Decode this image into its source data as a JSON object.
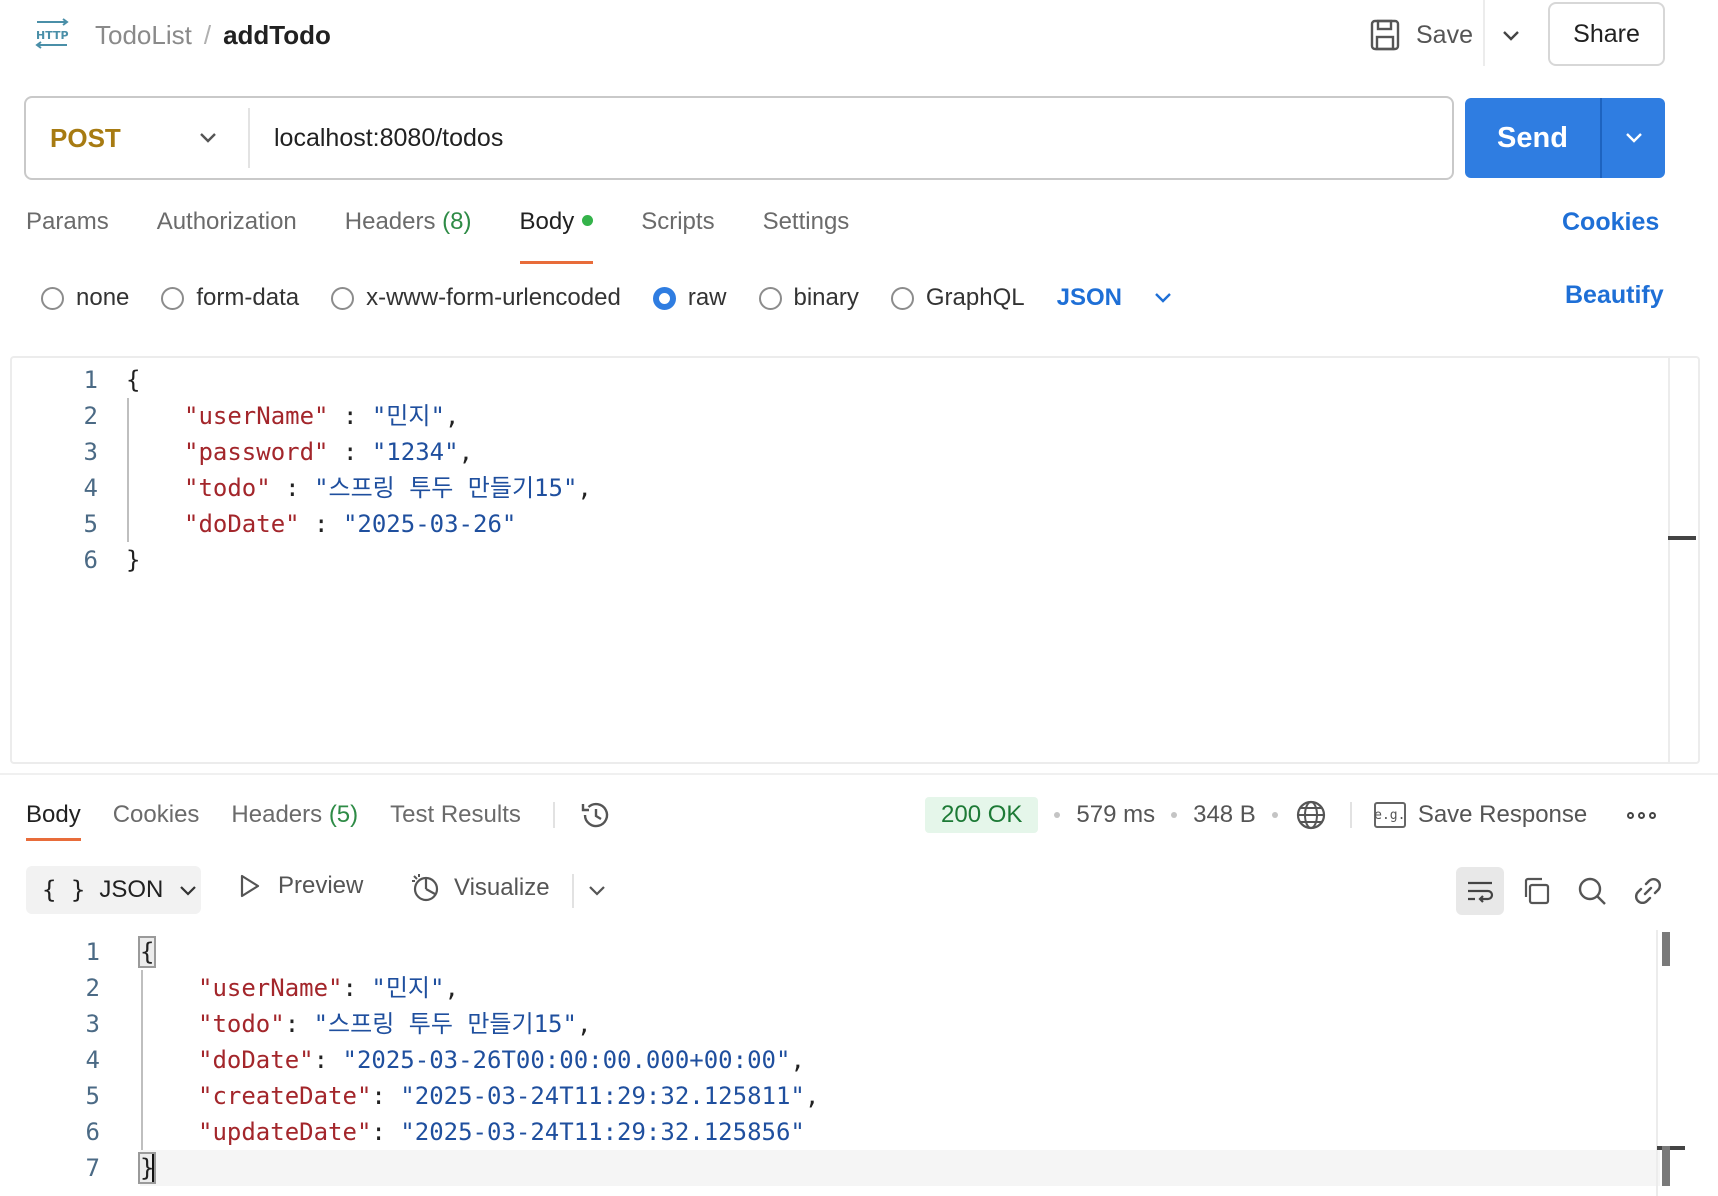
{
  "header": {
    "http_badge": "HTTP",
    "breadcrumb_parent": "TodoList",
    "breadcrumb_sep": "/",
    "breadcrumb_current": "addTodo",
    "save_label": "Save",
    "share_label": "Share"
  },
  "request": {
    "method": "POST",
    "url": "localhost:8080/todos",
    "send_label": "Send",
    "method_color": "#a77b12",
    "send_color": "#2f7de1"
  },
  "request_tabs": {
    "params": "Params",
    "authorization": "Authorization",
    "headers": "Headers",
    "headers_count": "(8)",
    "body": "Body",
    "scripts": "Scripts",
    "settings": "Settings",
    "cookies": "Cookies",
    "active": "Body"
  },
  "body_types": {
    "none": "none",
    "form_data": "form-data",
    "urlencoded": "x-www-form-urlencoded",
    "raw": "raw",
    "binary": "binary",
    "graphql": "GraphQL",
    "selected": "raw",
    "format": "JSON",
    "beautify": "Beautify"
  },
  "request_body": {
    "line_numbers": [
      "1",
      "2",
      "3",
      "4",
      "5",
      "6"
    ],
    "open_brace": "{",
    "close_brace": "}",
    "fields": [
      {
        "key": "\"userName\"",
        "sep": " : ",
        "value": "\"민지\"",
        "trail": ","
      },
      {
        "key": "\"password\"",
        "sep": " : ",
        "value": "\"1234\"",
        "trail": ","
      },
      {
        "key": "\"todo\"",
        "sep": " : ",
        "value": "\"스프링 투두 만들기15\"",
        "trail": ","
      },
      {
        "key": "\"doDate\"",
        "sep": " : ",
        "value": "\"2025-03-26\"",
        "trail": ""
      }
    ]
  },
  "response_tabs": {
    "body": "Body",
    "cookies": "Cookies",
    "headers": "Headers",
    "headers_count": "(5)",
    "test_results": "Test Results",
    "active": "Body"
  },
  "response_meta": {
    "status": "200 OK",
    "time": "579 ms",
    "size": "348 B",
    "save_response": "Save Response",
    "eg_label": "e.g."
  },
  "response_toolbar": {
    "format": "JSON",
    "braces": "{ }",
    "preview": "Preview",
    "visualize": "Visualize"
  },
  "response_body": {
    "line_numbers": [
      "1",
      "2",
      "3",
      "4",
      "5",
      "6",
      "7"
    ],
    "open_brace": "{",
    "close_brace": "}",
    "fields": [
      {
        "key": "\"userName\"",
        "sep": ": ",
        "value": "\"민지\"",
        "trail": ","
      },
      {
        "key": "\"todo\"",
        "sep": ": ",
        "value": "\"스프링 투두 만들기15\"",
        "trail": ","
      },
      {
        "key": "\"doDate\"",
        "sep": ": ",
        "value": "\"2025-03-26T00:00:00.000+00:00\"",
        "trail": ","
      },
      {
        "key": "\"createDate\"",
        "sep": ": ",
        "value": "\"2025-03-24T11:29:32.125811\"",
        "trail": ","
      },
      {
        "key": "\"updateDate\"",
        "sep": ": ",
        "value": "\"2025-03-24T11:29:32.125856\"",
        "trail": ""
      }
    ]
  }
}
